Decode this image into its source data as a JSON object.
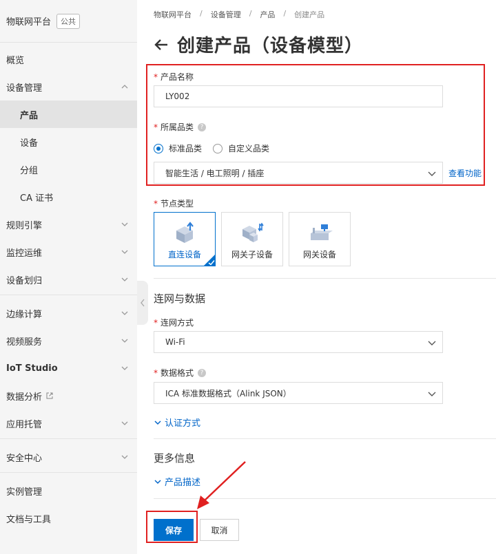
{
  "sidebar": {
    "title": "物联网平台",
    "badge": "公共",
    "items": [
      {
        "label": "概览"
      },
      {
        "label": "设备管理"
      },
      {
        "label": "产品"
      },
      {
        "label": "设备"
      },
      {
        "label": "分组"
      },
      {
        "label": "CA 证书"
      },
      {
        "label": "规则引擎"
      },
      {
        "label": "监控运维"
      },
      {
        "label": "设备划归"
      },
      {
        "label": "边缘计算"
      },
      {
        "label": "视频服务"
      },
      {
        "label": "IoT Studio"
      },
      {
        "label": "数据分析"
      },
      {
        "label": "应用托管"
      },
      {
        "label": "安全中心"
      },
      {
        "label": "实例管理"
      },
      {
        "label": "文档与工具"
      }
    ]
  },
  "breadcrumb": {
    "items": [
      "物联网平台",
      "设备管理",
      "产品",
      "创建产品"
    ],
    "separator": "/"
  },
  "page": {
    "title": "创建产品（设备模型）"
  },
  "form": {
    "required_mark": "*",
    "product_name": {
      "label": "产品名称",
      "value": "LY002"
    },
    "category": {
      "label": "所属品类",
      "options": [
        "标准品类",
        "自定义品类"
      ],
      "selected": "标准品类",
      "value": "智能生活 / 电工照明 / 插座",
      "link": "查看功能"
    },
    "node_type": {
      "label": "节点类型",
      "options": [
        "直连设备",
        "网关子设备",
        "网关设备"
      ],
      "selected": "直连设备"
    },
    "network_section": {
      "title": "连网与数据",
      "network_mode": {
        "label": "连网方式",
        "value": "Wi-Fi"
      },
      "data_format": {
        "label": "数据格式",
        "value": "ICA 标准数据格式（Alink JSON）"
      },
      "auth_link": "认证方式"
    },
    "more_section": {
      "title": "更多信息",
      "description_link": "产品描述"
    }
  },
  "actions": {
    "save": "保存",
    "cancel": "取消"
  },
  "colors": {
    "accent": "#0070cc",
    "annotation": "#e02020",
    "sidebar_bg": "#f5f5f5"
  }
}
